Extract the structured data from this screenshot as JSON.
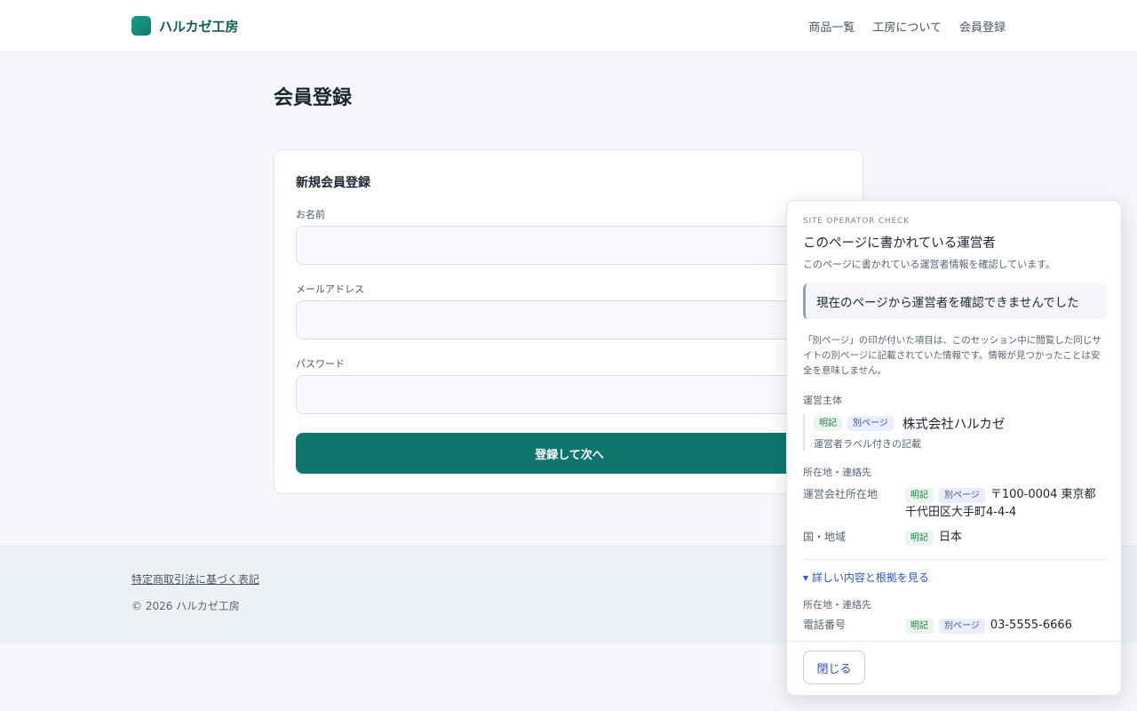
{
  "site": {
    "name": "ハルカゼ工房",
    "nav": [
      "商品一覧",
      "工房について",
      "会員登録"
    ]
  },
  "page": {
    "title": "会員登録",
    "form": {
      "title": "新規会員登録",
      "fields": [
        {
          "label": "お名前",
          "value": ""
        },
        {
          "label": "メールアドレス",
          "value": ""
        },
        {
          "label": "パスワード",
          "value": ""
        }
      ],
      "submit_label": "登録して次へ"
    }
  },
  "footer": {
    "link": "特定商取引法に基づく表記",
    "copyright": "© 2026 ハルカゼ工房"
  },
  "panel": {
    "eyebrow": "SITE OPERATOR CHECK",
    "title": "このページに書かれている運営者",
    "description": "このページに書かれている運営者情報を確認しています。",
    "notice": "現在のページから運営者を確認できませんでした",
    "note": "「別ページ」の印が付いた項目は、このセッション中に閲覧した同じサイトの別ページに記載されていた情報です。情報が見つかったことは安全を意味しません。",
    "operator_section": "運営主体",
    "operator": {
      "badges": [
        "明記",
        "別ページ"
      ],
      "name": "株式会社ハルカゼ",
      "sub": "運営者ラベル付きの記載"
    },
    "contact_section": "所在地・連絡先",
    "contact_rows": [
      {
        "key": "運営会社所在地",
        "badges": [
          "明記",
          "別ページ"
        ],
        "value": "〒100-0004 東京都千代田区大手町4-4-4"
      },
      {
        "key": "国・地域",
        "badges": [
          "明記"
        ],
        "value": "日本"
      }
    ],
    "details_link": "▾ 詳しい内容と根拠を見る",
    "details_section": "所在地・連絡先",
    "details_rows": [
      {
        "key": "電話番号",
        "badges": [
          "明記",
          "別ページ"
        ],
        "value": "03-5555-6666"
      }
    ],
    "close_label": "閉じる"
  }
}
